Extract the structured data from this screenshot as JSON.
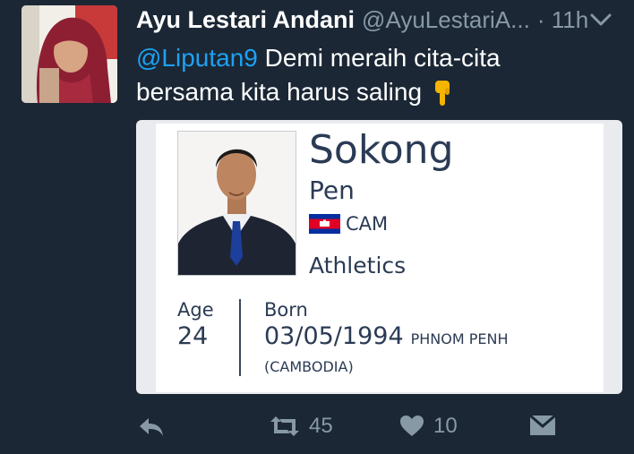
{
  "tweet": {
    "display_name": "Ayu Lestari Andani",
    "handle": "@AyuLestariA...",
    "time": "· 11h",
    "mention": "@Liputan9",
    "text": "Demi meraih cita-cita bersama kita harus saling",
    "emoji": "pointing-down-hand"
  },
  "card": {
    "surname": "Sokong",
    "given_name": "Pen",
    "country_code": "CAM",
    "sport": "Athletics",
    "age_label": "Age",
    "age_value": "24",
    "born_label": "Born",
    "born_date": "03/05/1994",
    "born_city": "PHNOM PENH",
    "born_country": "(CAMBODIA)"
  },
  "actions": {
    "retweets": "45",
    "likes": "10"
  },
  "colors": {
    "background": "#1b2735",
    "mention": "#1da1f2",
    "muted": "#8899a6",
    "card_text": "#2b3b55"
  }
}
